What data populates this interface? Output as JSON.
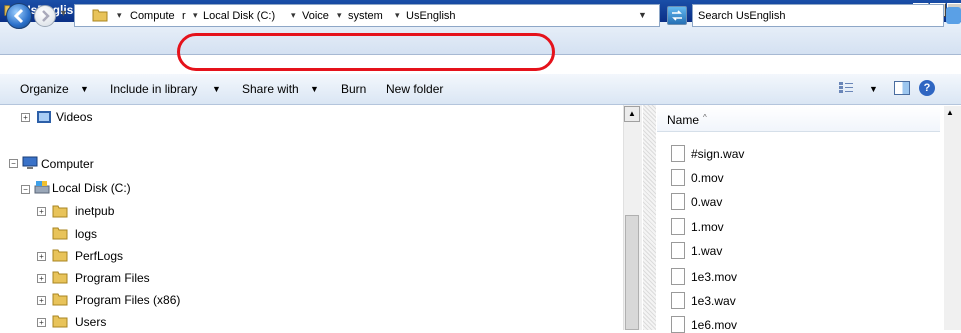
{
  "window": {
    "title": "UsEnglish"
  },
  "address_bar": {
    "crumbs": [
      "Compute",
      "r",
      "Local Disk (C:)",
      "Voice",
      "system",
      "UsEnglish"
    ],
    "search_placeholder": "Search UsEnglish"
  },
  "toolbar": {
    "organize": "Organize",
    "include_in_library": "Include in library",
    "share_with": "Share with",
    "burn": "Burn",
    "new_folder": "New folder"
  },
  "nav_tree": [
    {
      "label": "Videos",
      "level": 1,
      "expander": "+"
    },
    {
      "label": "Computer",
      "level": 0,
      "expander": "−"
    },
    {
      "label": "Local Disk (C:)",
      "level": 1,
      "expander": "−"
    },
    {
      "label": "inetpub",
      "level": 2,
      "expander": "+"
    },
    {
      "label": "logs",
      "level": 2,
      "expander": ""
    },
    {
      "label": "PerfLogs",
      "level": 2,
      "expander": "+"
    },
    {
      "label": "Program Files",
      "level": 2,
      "expander": "+"
    },
    {
      "label": "Program Files (x86)",
      "level": 2,
      "expander": "+"
    },
    {
      "label": "Users",
      "level": 2,
      "expander": "+"
    }
  ],
  "file_list": {
    "column_name": "Name",
    "files": [
      "#sign.wav",
      "0.mov",
      "0.wav",
      "1.mov",
      "1.wav",
      "1e3.mov",
      "1e3.wav",
      "1e6.mov"
    ]
  },
  "colors": {
    "annotation": "#e5121b",
    "titlebar": "#0b2f86"
  },
  "icons": [
    "folder-icon",
    "back-arrow-icon",
    "forward-arrow-icon",
    "refresh-icon",
    "search-icon",
    "views-icon",
    "preview-pane-icon",
    "help-icon",
    "file-icon",
    "computer-icon",
    "drive-icon",
    "video-library-icon"
  ]
}
